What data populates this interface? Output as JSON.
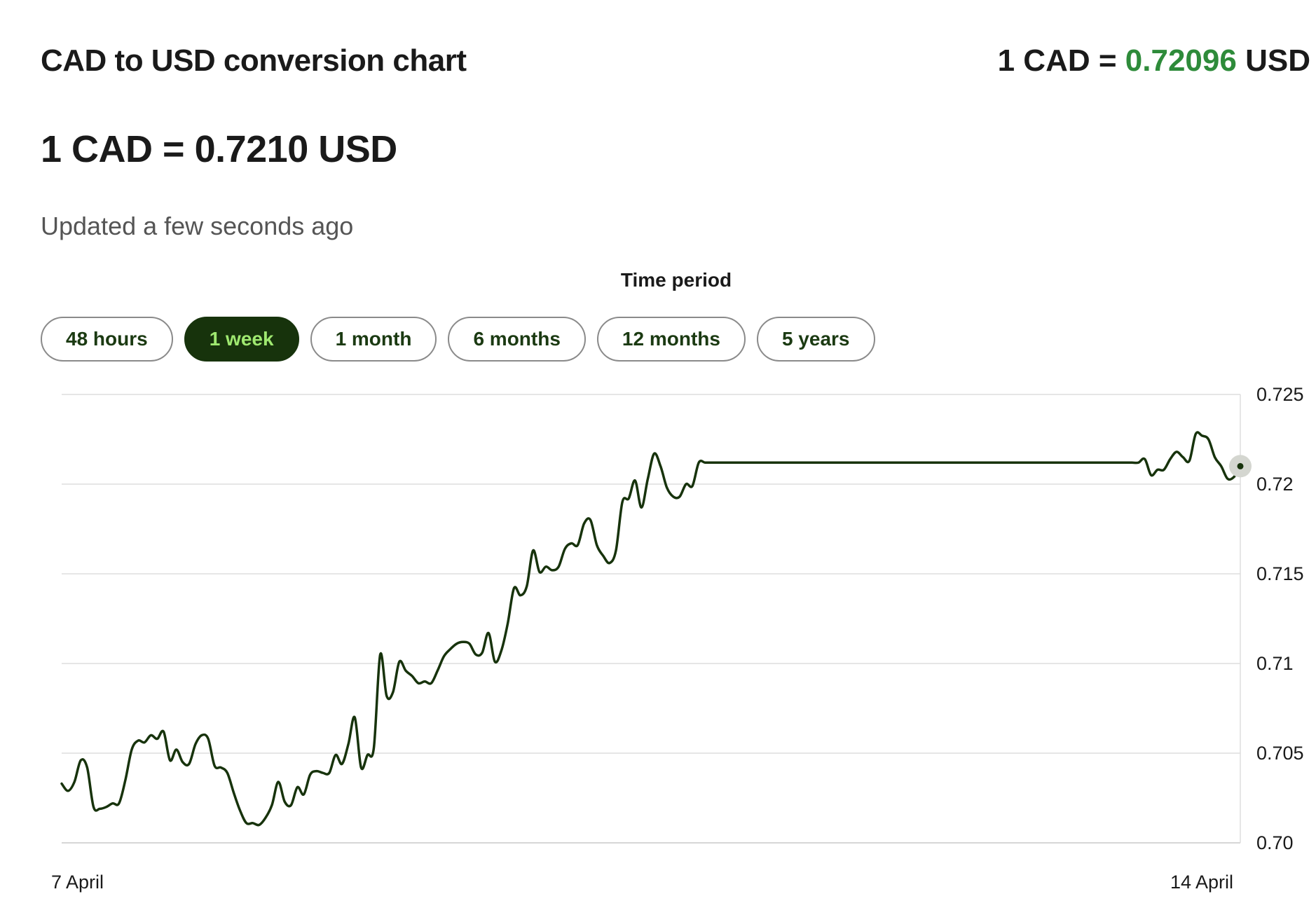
{
  "header": {
    "title": "CAD to USD conversion chart",
    "rate_prefix": "1 CAD =",
    "rate_value": "0.72096",
    "rate_suffix": "USD"
  },
  "summary": {
    "big_rate": "1 CAD = 0.7210 USD",
    "updated": "Updated a few seconds ago"
  },
  "period": {
    "label": "Time period",
    "options": [
      "48 hours",
      "1 week",
      "1 month",
      "6 months",
      "12 months",
      "5 years"
    ],
    "selected": "1 week"
  },
  "colors": {
    "line": "#17330c",
    "accent_green": "#2e8b3a",
    "active_button_bg": "#17330c",
    "active_button_text": "#9fe870",
    "grid": "#dddddd"
  },
  "chart_data": {
    "type": "line",
    "x_labels": [
      "7 April",
      "14 April"
    ],
    "ylim": [
      0.7,
      0.725
    ],
    "y_ticks": [
      "0.725",
      "0.72",
      "0.715",
      "0.71",
      "0.705",
      "0.70"
    ],
    "y_tick_values": [
      0.725,
      0.72,
      0.715,
      0.71,
      0.705,
      0.7
    ],
    "grid": true,
    "y_axis_position": "right",
    "series": [
      {
        "values": [
          0.7033,
          0.7029,
          0.7034,
          0.7046,
          0.7042,
          0.702,
          0.7019,
          0.702,
          0.7022,
          0.7022,
          0.7035,
          0.7052,
          0.7057,
          0.7056,
          0.706,
          0.7058,
          0.7062,
          0.7046,
          0.7052,
          0.7045,
          0.7044,
          0.7055,
          0.706,
          0.7058,
          0.7043,
          0.7042,
          0.7039,
          0.7028,
          0.7018,
          0.7011,
          0.7011,
          0.701,
          0.7014,
          0.7021,
          0.7034,
          0.7023,
          0.7021,
          0.7031,
          0.7027,
          0.7038,
          0.704,
          0.7039,
          0.7039,
          0.7049,
          0.7044,
          0.7055,
          0.707,
          0.7042,
          0.7049,
          0.7053,
          0.7105,
          0.7082,
          0.7084,
          0.7101,
          0.7096,
          0.7093,
          0.7089,
          0.709,
          0.7089,
          0.7096,
          0.7104,
          0.7108,
          0.7111,
          0.7112,
          0.7111,
          0.7105,
          0.7106,
          0.7117,
          0.7101,
          0.7107,
          0.7122,
          0.7142,
          0.7138,
          0.7143,
          0.7163,
          0.7151,
          0.7154,
          0.7152,
          0.7154,
          0.7164,
          0.7167,
          0.7166,
          0.7178,
          0.718,
          0.7166,
          0.716,
          0.7156,
          0.7163,
          0.719,
          0.7192,
          0.7202,
          0.7187,
          0.7203,
          0.7217,
          0.721,
          0.7198,
          0.7193,
          0.7193,
          0.72,
          0.7199,
          0.7212,
          0.7212,
          0.7212,
          0.7212,
          0.7212,
          0.7212,
          0.7212,
          0.7212,
          0.7212,
          0.7212,
          0.7212,
          0.7212,
          0.7212,
          0.7212,
          0.7212,
          0.7212,
          0.7212,
          0.7212,
          0.7212,
          0.7212,
          0.7212,
          0.7212,
          0.7212,
          0.7212,
          0.7212,
          0.7212,
          0.7212,
          0.7212,
          0.7212,
          0.7212,
          0.7212,
          0.7212,
          0.7212,
          0.7212,
          0.7212,
          0.7212,
          0.7212,
          0.7212,
          0.7212,
          0.7212,
          0.7212,
          0.7212,
          0.7212,
          0.7212,
          0.7212,
          0.7212,
          0.7212,
          0.7212,
          0.7212,
          0.7212,
          0.7212,
          0.7212,
          0.7212,
          0.7212,
          0.7212,
          0.7212,
          0.7212,
          0.7212,
          0.7212,
          0.7212,
          0.7212,
          0.7212,
          0.7212,
          0.7212,
          0.7212,
          0.7212,
          0.7212,
          0.7212,
          0.7212,
          0.7212,
          0.7214,
          0.7205,
          0.7208,
          0.7208,
          0.7214,
          0.7218,
          0.7215,
          0.7213,
          0.7228,
          0.7227,
          0.7225,
          0.7215,
          0.721,
          0.7203,
          0.7204,
          0.721
        ]
      }
    ]
  }
}
